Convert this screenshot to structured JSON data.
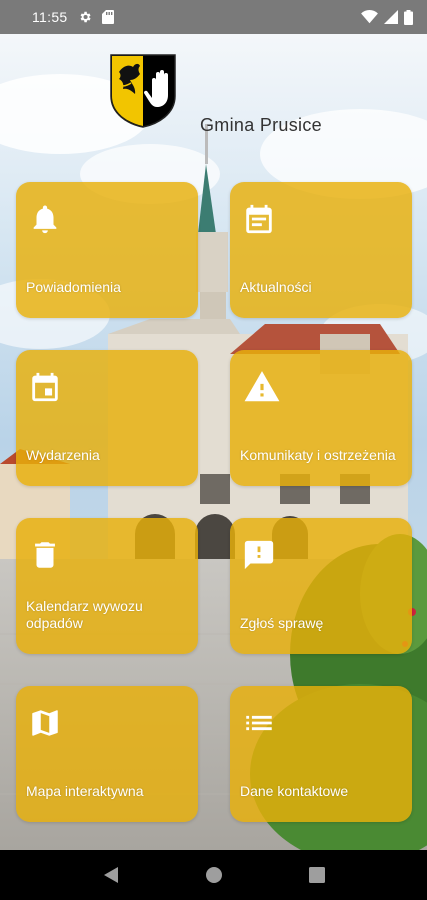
{
  "status_bar": {
    "time": "11:55"
  },
  "header": {
    "title": "Gmina Prusice"
  },
  "tiles": [
    {
      "label": "Powiadomienia",
      "icon": "bell-icon"
    },
    {
      "label": "Aktualności",
      "icon": "news-icon"
    },
    {
      "label": "Wydarzenia",
      "icon": "calendar-icon"
    },
    {
      "label": "Komunikaty i ostrzeżenia",
      "icon": "warning-icon"
    },
    {
      "label": "Kalendarz wywozu odpadów",
      "icon": "trash-icon"
    },
    {
      "label": "Zgłoś sprawę",
      "icon": "report-icon"
    },
    {
      "label": "Mapa interaktywna",
      "icon": "map-icon"
    },
    {
      "label": "Dane kontaktowe",
      "icon": "list-icon"
    }
  ],
  "colors": {
    "tile": "#E8B00A",
    "status_bar": "#7A7A7A",
    "nav_bar": "#000000"
  }
}
